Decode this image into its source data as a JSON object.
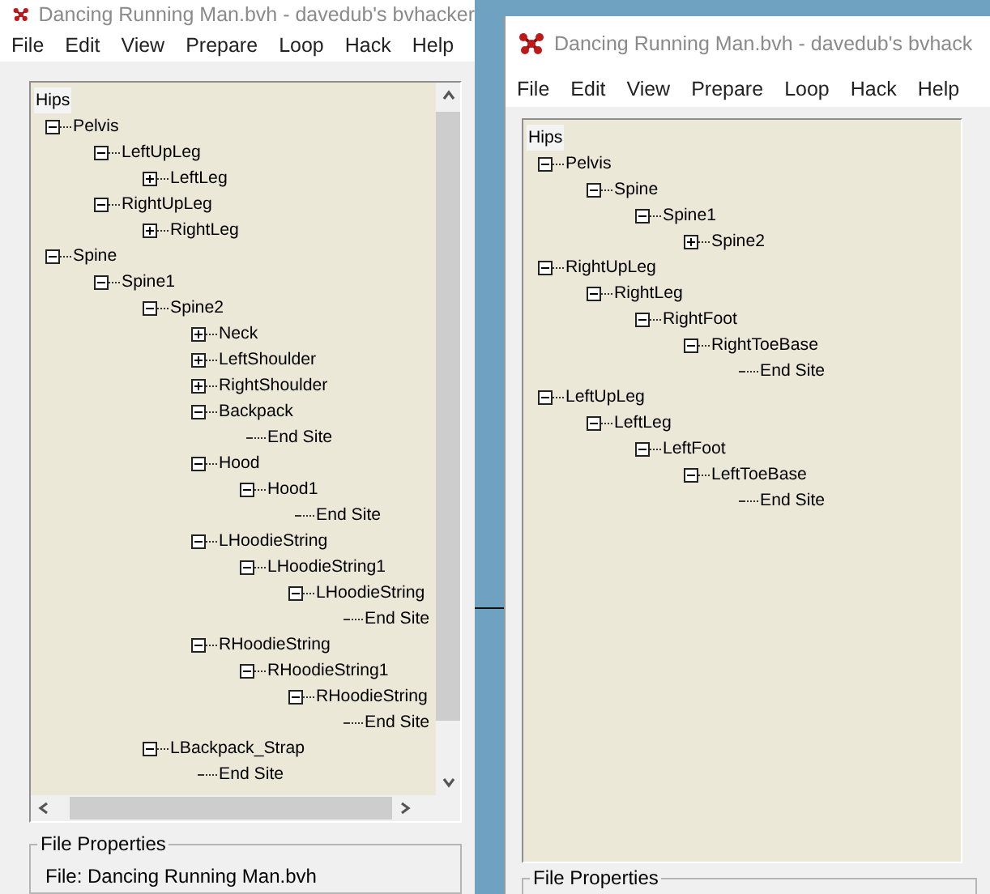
{
  "windows": [
    {
      "title": "Dancing Running Man.bvh - davedub's bvhacker",
      "menu": [
        "File",
        "Edit",
        "View",
        "Prepare",
        "Loop",
        "Hack",
        "Help"
      ],
      "tree": [
        {
          "label": "Hips",
          "selected": true,
          "children": [
            {
              "label": "Pelvis",
              "expanded": true,
              "selected": false,
              "children": [
                {
                  "label": "LeftUpLeg",
                  "expanded": true,
                  "selected": false,
                  "children": [
                    {
                      "label": "LeftLeg",
                      "expanded": false,
                      "selected": false
                    }
                  ]
                },
                {
                  "label": "RightUpLeg",
                  "expanded": true,
                  "selected": false,
                  "children": [
                    {
                      "label": "RightLeg",
                      "expanded": false,
                      "selected": false
                    }
                  ]
                }
              ]
            },
            {
              "label": "Spine",
              "expanded": true,
              "selected": false,
              "children": [
                {
                  "label": "Spine1",
                  "expanded": true,
                  "selected": false,
                  "children": [
                    {
                      "label": "Spine2",
                      "expanded": true,
                      "selected": false,
                      "children": [
                        {
                          "label": "Neck",
                          "expanded": false,
                          "selected": false
                        },
                        {
                          "label": "LeftShoulder",
                          "expanded": false,
                          "selected": false
                        },
                        {
                          "label": "RightShoulder",
                          "expanded": false,
                          "selected": false
                        },
                        {
                          "label": "Backpack",
                          "expanded": true,
                          "selected": false,
                          "children": [
                            {
                              "label": "End Site",
                              "selected": false
                            }
                          ]
                        },
                        {
                          "label": "Hood",
                          "expanded": true,
                          "selected": false,
                          "children": [
                            {
                              "label": "Hood1",
                              "expanded": true,
                              "selected": false,
                              "children": [
                                {
                                  "label": "End Site",
                                  "selected": false
                                }
                              ]
                            }
                          ]
                        },
                        {
                          "label": "LHoodieString",
                          "expanded": true,
                          "selected": false,
                          "children": [
                            {
                              "label": "LHoodieString1",
                              "expanded": true,
                              "selected": false,
                              "children": [
                                {
                                  "label": "LHoodieString",
                                  "expanded": true,
                                  "selected": false,
                                  "children": [
                                    {
                                      "label": "End Site",
                                      "selected": false
                                    }
                                  ]
                                }
                              ]
                            }
                          ]
                        },
                        {
                          "label": "RHoodieString",
                          "expanded": true,
                          "selected": false,
                          "children": [
                            {
                              "label": "RHoodieString1",
                              "expanded": true,
                              "selected": false,
                              "children": [
                                {
                                  "label": "RHoodieString",
                                  "expanded": true,
                                  "selected": false,
                                  "children": [
                                    {
                                      "label": "End Site",
                                      "selected": false
                                    }
                                  ]
                                }
                              ]
                            }
                          ]
                        }
                      ]
                    },
                    {
                      "label": "LBackpack_Strap",
                      "expanded": true,
                      "selected": false,
                      "children": [
                        {
                          "label": "End Site",
                          "selected": false
                        }
                      ]
                    }
                  ]
                }
              ]
            }
          ]
        }
      ],
      "scrollbars": true,
      "file_properties": {
        "legend": "File Properties",
        "file": "File: Dancing Running Man.bvh"
      }
    },
    {
      "title": "Dancing Running Man.bvh - davedub's bvhack",
      "menu": [
        "File",
        "Edit",
        "View",
        "Prepare",
        "Loop",
        "Hack",
        "Help"
      ],
      "tree": [
        {
          "label": "Hips",
          "selected": true,
          "children": [
            {
              "label": "Pelvis",
              "expanded": true,
              "selected": false,
              "children": [
                {
                  "label": "Spine",
                  "expanded": true,
                  "selected": false,
                  "children": [
                    {
                      "label": "Spine1",
                      "expanded": true,
                      "selected": false,
                      "children": [
                        {
                          "label": "Spine2",
                          "expanded": false,
                          "selected": false
                        }
                      ]
                    }
                  ]
                }
              ]
            },
            {
              "label": "RightUpLeg",
              "expanded": true,
              "selected": false,
              "children": [
                {
                  "label": "RightLeg",
                  "expanded": true,
                  "selected": false,
                  "children": [
                    {
                      "label": "RightFoot",
                      "expanded": true,
                      "selected": false,
                      "children": [
                        {
                          "label": "RightToeBase",
                          "expanded": true,
                          "selected": false,
                          "children": [
                            {
                              "label": "End Site",
                              "selected": false
                            }
                          ]
                        }
                      ]
                    }
                  ]
                }
              ]
            },
            {
              "label": "LeftUpLeg",
              "expanded": true,
              "selected": false,
              "children": [
                {
                  "label": "LeftLeg",
                  "expanded": true,
                  "selected": false,
                  "children": [
                    {
                      "label": "LeftFoot",
                      "expanded": true,
                      "selected": false,
                      "children": [
                        {
                          "label": "LeftToeBase",
                          "expanded": true,
                          "selected": false,
                          "children": [
                            {
                              "label": "End Site",
                              "selected": false
                            }
                          ]
                        }
                      ]
                    }
                  ]
                }
              ]
            }
          ]
        }
      ],
      "scrollbars": false,
      "file_properties": {
        "legend": "File Properties"
      }
    }
  ]
}
